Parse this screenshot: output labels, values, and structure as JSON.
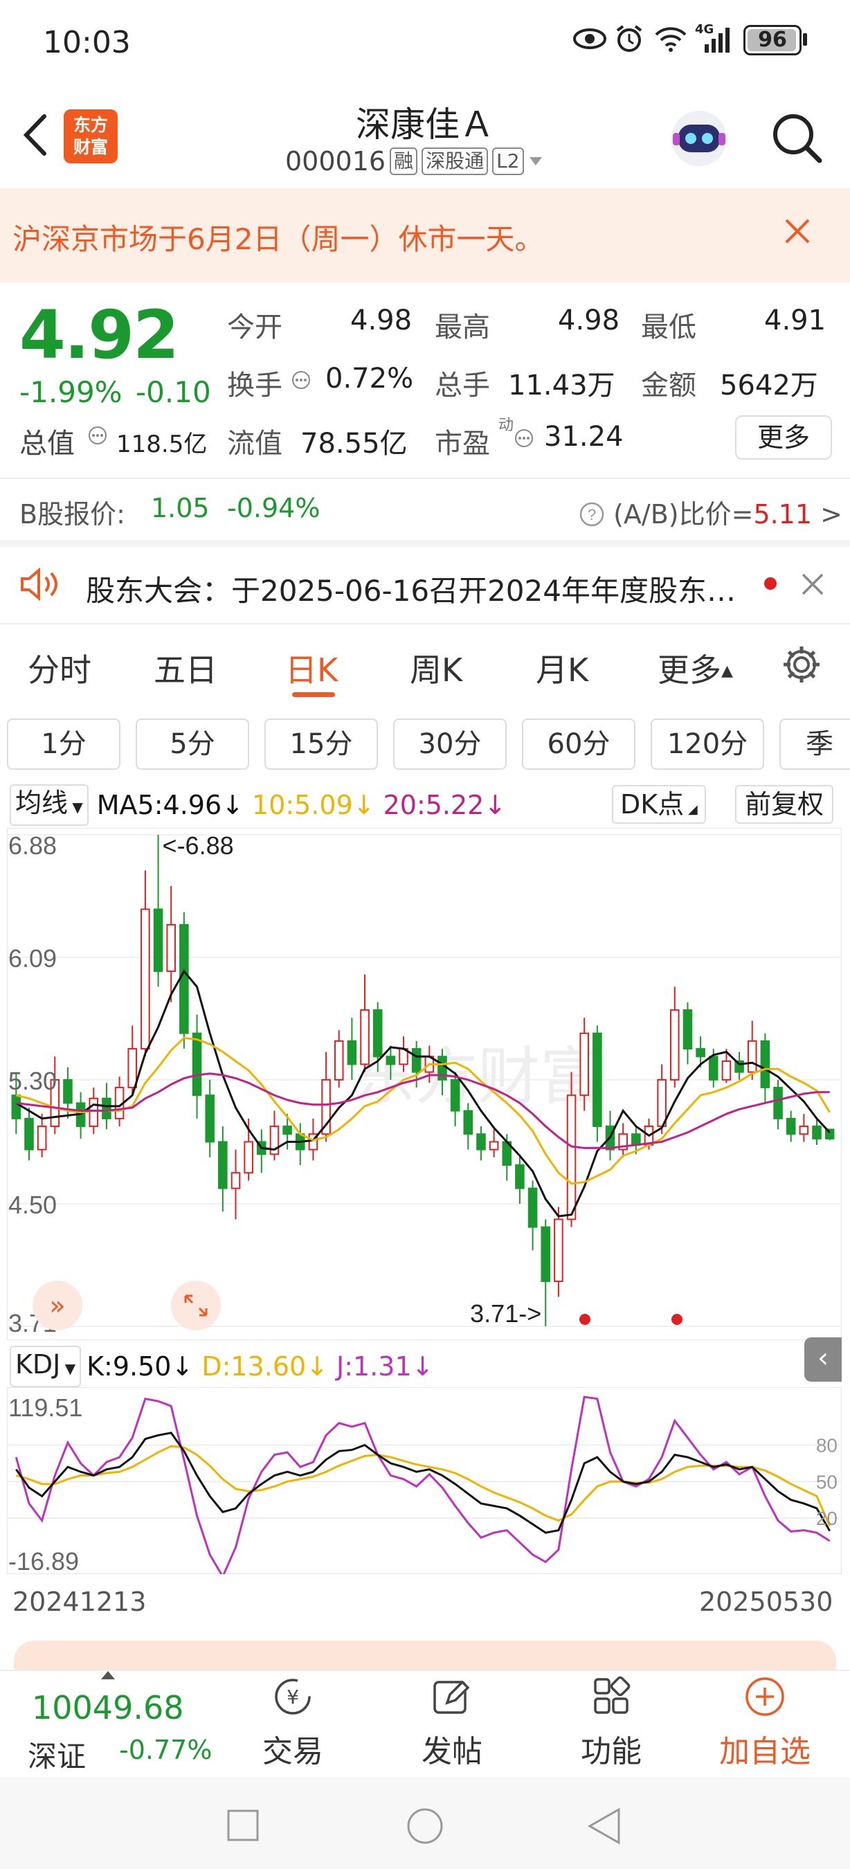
{
  "status": {
    "time": "10:03",
    "battery": "96",
    "network": "4G"
  },
  "header": {
    "logo_line1": "东方",
    "logo_line2": "财富",
    "stock_name": "深康佳Ａ",
    "stock_code": "000016",
    "tags": [
      "融",
      "深股通",
      "L2"
    ]
  },
  "notice": {
    "text": "沪深京市场于6月2日（周一）休市一天。"
  },
  "quote": {
    "price": "4.92",
    "change_pct": "-1.99%",
    "change_abs": "-0.10",
    "open_label": "今开",
    "open": "4.98",
    "high_label": "最高",
    "high": "4.98",
    "low_label": "最低",
    "low": "4.91",
    "turnover_label": "换手",
    "turnover": "0.72%",
    "volume_label": "总手",
    "volume": "11.43万",
    "amount_label": "金额",
    "amount": "5642万",
    "mktcap_label": "总值",
    "mktcap": "118.5亿",
    "float_label": "流值",
    "float_cap": "78.55亿",
    "pe_label": "市盈",
    "pe_sup": "动",
    "pe": "31.24",
    "more_label": "更多"
  },
  "bshare": {
    "label": "B股报价:",
    "price": "1.05",
    "pct": "-0.94%",
    "ratio_label": "(A/B)比价=",
    "ratio": "5.11"
  },
  "meeting": {
    "text": "股东大会：于2025-06-16召开2024年年度股东…"
  },
  "tabs": [
    "分时",
    "五日",
    "日K",
    "周K",
    "月K",
    "更多"
  ],
  "periods": [
    "1分",
    "5分",
    "15分",
    "30分",
    "60分",
    "120分",
    "季K"
  ],
  "ma": {
    "selector": "均线",
    "ma5": "MA5:4.96",
    "ma10": "10:5.09",
    "ma20": "20:5.22",
    "dk_label": "DK点",
    "adjust_label": "前复权",
    "colors": {
      "ma5": "#111111",
      "ma10": "#f0b400",
      "ma20": "#c0208a"
    }
  },
  "kdj": {
    "selector": "KDJ",
    "k": "K:9.50",
    "d": "D:13.60",
    "j": "J:1.31",
    "levels": [
      "80",
      "50",
      "20"
    ]
  },
  "chart_data": {
    "type": "candlestick",
    "y_ticks": [
      "6.88",
      "6.09",
      "5.30",
      "4.50",
      "3.71"
    ],
    "high_marker": "<-6.88",
    "low_marker": "3.71->",
    "kdj_ticks": [
      "119.51",
      "-16.89"
    ],
    "x_start": "20241213",
    "x_end": "20250530",
    "ylim": [
      3.71,
      6.88
    ],
    "candles": [
      [
        5.2,
        5.05,
        5.35,
        4.95
      ],
      [
        5.05,
        4.85,
        5.12,
        4.78
      ],
      [
        4.85,
        5.0,
        5.08,
        4.8
      ],
      [
        5.0,
        5.3,
        5.45,
        4.95
      ],
      [
        5.3,
        5.15,
        5.38,
        5.05
      ],
      [
        5.15,
        5.0,
        5.22,
        4.92
      ],
      [
        5.0,
        5.18,
        5.25,
        4.95
      ],
      [
        5.18,
        5.05,
        5.28,
        4.98
      ],
      [
        5.05,
        5.25,
        5.32,
        5.0
      ],
      [
        5.25,
        5.5,
        5.65,
        5.2
      ],
      [
        5.5,
        6.4,
        6.65,
        5.45
      ],
      [
        6.4,
        6.0,
        6.88,
        5.9
      ],
      [
        6.0,
        6.3,
        6.55,
        5.8
      ],
      [
        6.3,
        5.6,
        6.38,
        5.5
      ],
      [
        5.6,
        5.2,
        5.72,
        5.05
      ],
      [
        5.2,
        4.9,
        5.3,
        4.8
      ],
      [
        4.9,
        4.6,
        5.0,
        4.45
      ],
      [
        4.6,
        4.7,
        4.85,
        4.4
      ],
      [
        4.7,
        4.9,
        5.05,
        4.65
      ],
      [
        4.9,
        4.82,
        4.98,
        4.7
      ],
      [
        4.82,
        5.0,
        5.1,
        4.78
      ],
      [
        5.0,
        4.95,
        5.08,
        4.85
      ],
      [
        4.95,
        4.85,
        5.02,
        4.75
      ],
      [
        4.85,
        4.95,
        5.05,
        4.78
      ],
      [
        4.95,
        5.3,
        5.48,
        4.9
      ],
      [
        5.3,
        5.55,
        5.62,
        5.25
      ],
      [
        5.55,
        5.4,
        5.7,
        5.3
      ],
      [
        5.4,
        5.75,
        5.98,
        5.35
      ],
      [
        5.75,
        5.45,
        5.8,
        5.35
      ],
      [
        5.45,
        5.4,
        5.52,
        5.3
      ],
      [
        5.4,
        5.5,
        5.58,
        5.35
      ],
      [
        5.5,
        5.35,
        5.55,
        5.25
      ],
      [
        5.35,
        5.45,
        5.52,
        5.28
      ],
      [
        5.45,
        5.3,
        5.5,
        5.2
      ],
      [
        5.3,
        5.1,
        5.35,
        5.0
      ],
      [
        5.1,
        4.95,
        5.15,
        4.85
      ],
      [
        4.95,
        4.85,
        5.0,
        4.78
      ],
      [
        4.85,
        4.9,
        4.98,
        4.8
      ],
      [
        4.9,
        4.75,
        4.95,
        4.65
      ],
      [
        4.75,
        4.6,
        4.8,
        4.5
      ],
      [
        4.6,
        4.35,
        4.65,
        4.2
      ],
      [
        4.35,
        4.0,
        4.4,
        3.71
      ],
      [
        4.0,
        4.4,
        4.48,
        3.9
      ],
      [
        4.4,
        5.2,
        5.35,
        4.35
      ],
      [
        5.2,
        5.6,
        5.7,
        5.1
      ],
      [
        5.6,
        5.0,
        5.65,
        4.9
      ],
      [
        5.0,
        4.85,
        5.1,
        4.78
      ],
      [
        4.85,
        4.95,
        5.02,
        4.8
      ],
      [
        4.95,
        4.88,
        5.0,
        4.82
      ],
      [
        4.88,
        5.0,
        5.05,
        4.85
      ],
      [
        5.0,
        5.3,
        5.4,
        4.95
      ],
      [
        5.3,
        5.75,
        5.9,
        5.25
      ],
      [
        5.75,
        5.5,
        5.8,
        5.4
      ],
      [
        5.5,
        5.45,
        5.58,
        5.38
      ],
      [
        5.45,
        5.3,
        5.5,
        5.25
      ],
      [
        5.3,
        5.42,
        5.5,
        5.28
      ],
      [
        5.42,
        5.35,
        5.48,
        5.3
      ],
      [
        5.35,
        5.55,
        5.68,
        5.3
      ],
      [
        5.55,
        5.25,
        5.6,
        5.15
      ],
      [
        5.25,
        5.05,
        5.3,
        4.98
      ],
      [
        5.05,
        4.95,
        5.1,
        4.9
      ],
      [
        4.95,
        5.0,
        5.08,
        4.9
      ],
      [
        5.0,
        4.92,
        5.05,
        4.88
      ],
      [
        4.98,
        4.92,
        4.98,
        4.91
      ]
    ],
    "ma5": [
      5.15,
      5.1,
      5.05,
      5.06,
      5.07,
      5.08,
      5.14,
      5.13,
      5.13,
      5.2,
      5.47,
      5.64,
      5.85,
      6.0,
      5.9,
      5.6,
      5.33,
      5.12,
      4.98,
      4.86,
      4.85,
      4.9,
      4.9,
      4.91,
      5.01,
      5.12,
      5.2,
      5.37,
      5.42,
      5.51,
      5.5,
      5.45,
      5.45,
      5.4,
      5.34,
      5.23,
      5.1,
      4.99,
      4.9,
      4.81,
      4.71,
      4.53,
      4.42,
      4.43,
      4.61,
      4.84,
      4.93,
      5.1,
      5.0,
      4.94,
      4.99,
      5.16,
      5.31,
      5.4,
      5.46,
      5.48,
      5.4,
      5.41,
      5.37,
      5.32,
      5.24,
      5.16,
      5.05,
      4.96
    ],
    "ma10": [
      5.2,
      5.18,
      5.15,
      5.12,
      5.1,
      5.09,
      5.1,
      5.1,
      5.1,
      5.13,
      5.28,
      5.38,
      5.49,
      5.57,
      5.56,
      5.53,
      5.48,
      5.42,
      5.36,
      5.27,
      5.16,
      5.06,
      4.95,
      4.91,
      4.93,
      4.98,
      5.05,
      5.13,
      5.16,
      5.23,
      5.3,
      5.33,
      5.4,
      5.4,
      5.41,
      5.37,
      5.29,
      5.22,
      5.15,
      5.07,
      4.97,
      4.82,
      4.7,
      4.63,
      4.64,
      4.68,
      4.72,
      4.81,
      4.84,
      4.88,
      4.92,
      5.02,
      5.11,
      5.2,
      5.22,
      5.25,
      5.29,
      5.34,
      5.37,
      5.37,
      5.32,
      5.28,
      5.23,
      5.09
    ],
    "ma20": [
      5.15,
      5.14,
      5.13,
      5.12,
      5.11,
      5.1,
      5.1,
      5.1,
      5.11,
      5.12,
      5.18,
      5.22,
      5.27,
      5.31,
      5.33,
      5.34,
      5.33,
      5.31,
      5.28,
      5.24,
      5.2,
      5.17,
      5.15,
      5.14,
      5.14,
      5.15,
      5.17,
      5.2,
      5.22,
      5.25,
      5.28,
      5.3,
      5.33,
      5.33,
      5.32,
      5.3,
      5.27,
      5.24,
      5.2,
      5.15,
      5.08,
      5.0,
      4.93,
      4.87,
      4.86,
      4.86,
      4.86,
      4.87,
      4.88,
      4.89,
      4.9,
      4.93,
      4.96,
      5.0,
      5.04,
      5.08,
      5.11,
      5.13,
      5.15,
      5.17,
      5.19,
      5.21,
      5.22,
      5.22
    ],
    "kdj_K": [
      60,
      45,
      38,
      50,
      62,
      58,
      55,
      60,
      62,
      70,
      85,
      88,
      90,
      75,
      55,
      38,
      25,
      28,
      40,
      48,
      55,
      58,
      55,
      58,
      68,
      75,
      76,
      80,
      72,
      65,
      62,
      58,
      60,
      55,
      48,
      40,
      32,
      30,
      28,
      22,
      15,
      8,
      10,
      35,
      65,
      70,
      58,
      50,
      48,
      50,
      58,
      72,
      70,
      66,
      62,
      64,
      60,
      62,
      52,
      42,
      35,
      32,
      28,
      9.5
    ],
    "kdj_D": [
      55,
      52,
      48,
      48,
      52,
      55,
      55,
      57,
      58,
      62,
      68,
      74,
      79,
      78,
      72,
      63,
      52,
      44,
      42,
      43,
      46,
      50,
      52,
      54,
      58,
      63,
      67,
      71,
      72,
      70,
      67,
      64,
      62,
      60,
      57,
      52,
      46,
      41,
      37,
      33,
      28,
      22,
      18,
      23,
      35,
      46,
      50,
      50,
      49,
      49,
      52,
      58,
      62,
      63,
      63,
      63,
      62,
      62,
      59,
      54,
      48,
      43,
      38,
      13.6
    ],
    "kdj_J": [
      70,
      32,
      18,
      55,
      82,
      65,
      55,
      66,
      70,
      86,
      118,
      116,
      112,
      68,
      22,
      -10,
      -28,
      -4,
      36,
      58,
      72,
      74,
      62,
      66,
      88,
      98,
      95,
      98,
      72,
      55,
      52,
      46,
      56,
      45,
      30,
      16,
      4,
      8,
      10,
      0,
      -10,
      -16,
      -6,
      60,
      119.5,
      118,
      74,
      50,
      46,
      52,
      70,
      100,
      86,
      72,
      60,
      66,
      56,
      62,
      38,
      18,
      9,
      10,
      8,
      1.31
    ]
  },
  "bottom": {
    "index_value": "10049.68",
    "index_name": "深证",
    "index_pct": "-0.77%",
    "nav": [
      "交易",
      "发帖",
      "功能",
      "加自选"
    ]
  }
}
